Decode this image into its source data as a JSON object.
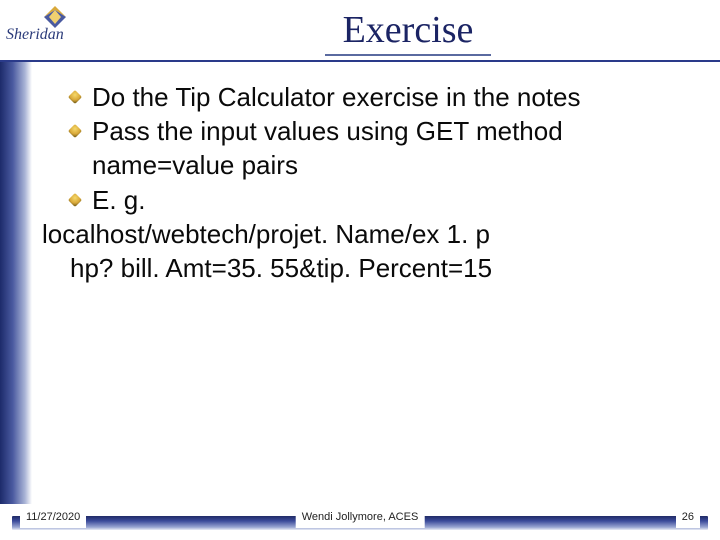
{
  "logo": {
    "text": "Sheridan"
  },
  "title": "Exercise",
  "bullets": [
    "Do the Tip Calculator exercise in the notes",
    "Pass the input values using GET method name=value pairs",
    "E. g."
  ],
  "example": {
    "line1": "localhost/webtech/projet. Name/ex 1. p",
    "line2": "hp? bill. Amt=35. 55&tip. Percent=15"
  },
  "footer": {
    "date": "11/27/2020",
    "author": "Wendi Jollymore, ACES",
    "page": "26"
  }
}
